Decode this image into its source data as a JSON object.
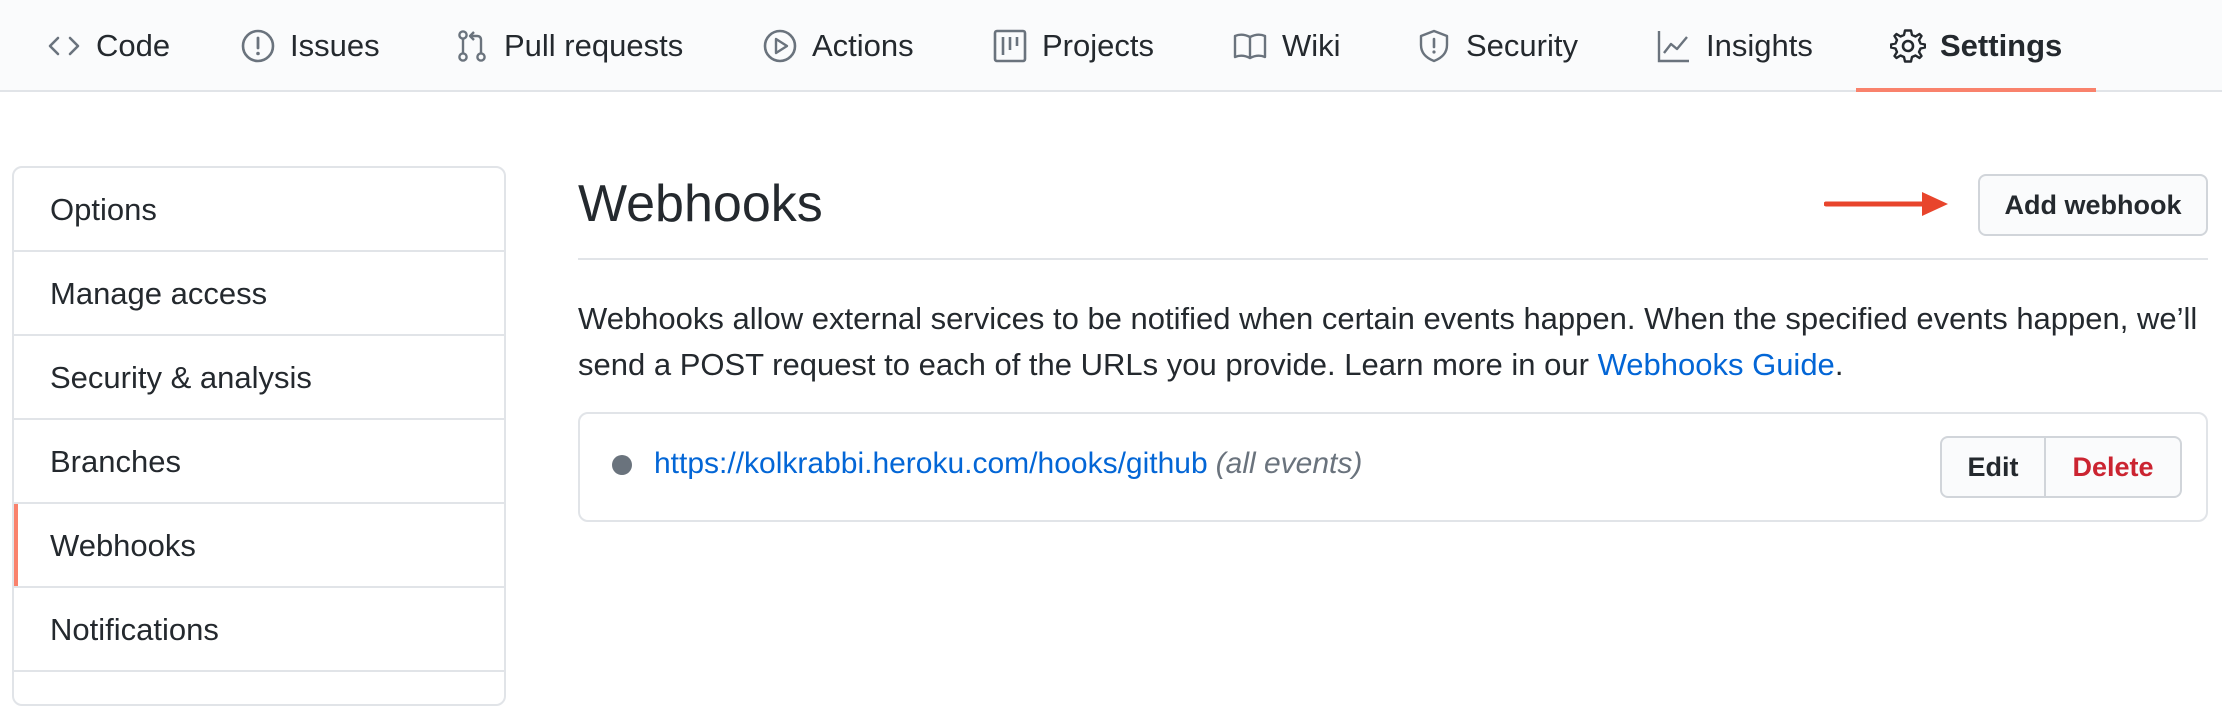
{
  "repo_nav": {
    "tabs": [
      {
        "label": "Code",
        "icon": "code-icon"
      },
      {
        "label": "Issues",
        "icon": "issue-opened-icon"
      },
      {
        "label": "Pull requests",
        "icon": "git-pull-request-icon"
      },
      {
        "label": "Actions",
        "icon": "play-icon"
      },
      {
        "label": "Projects",
        "icon": "project-icon"
      },
      {
        "label": "Wiki",
        "icon": "book-icon"
      },
      {
        "label": "Security",
        "icon": "shield-icon"
      },
      {
        "label": "Insights",
        "icon": "graph-icon"
      },
      {
        "label": "Settings",
        "icon": "gear-icon"
      }
    ],
    "selected": "Settings",
    "accent_color": "#f9826c"
  },
  "settings_menu": {
    "items": [
      {
        "label": "Options"
      },
      {
        "label": "Manage access"
      },
      {
        "label": "Security & analysis"
      },
      {
        "label": "Branches"
      },
      {
        "label": "Webhooks"
      },
      {
        "label": "Notifications"
      }
    ],
    "selected": "Webhooks"
  },
  "main": {
    "title": "Webhooks",
    "add_button_label": "Add webhook",
    "description_before": "Webhooks allow external services to be notified when certain events happen. When the specified events happen, we’ll send a POST request to each of the URLs you provide. Learn more in our ",
    "description_link": "Webhooks Guide",
    "description_after": ".",
    "annotation_arrow_color": "#e8452c"
  },
  "webhooks": [
    {
      "url": "https://kolkrabbi.heroku.com/hooks/github",
      "events": "(all events)",
      "status_color": "#6a737d",
      "edit_label": "Edit",
      "delete_label": "Delete"
    }
  ]
}
